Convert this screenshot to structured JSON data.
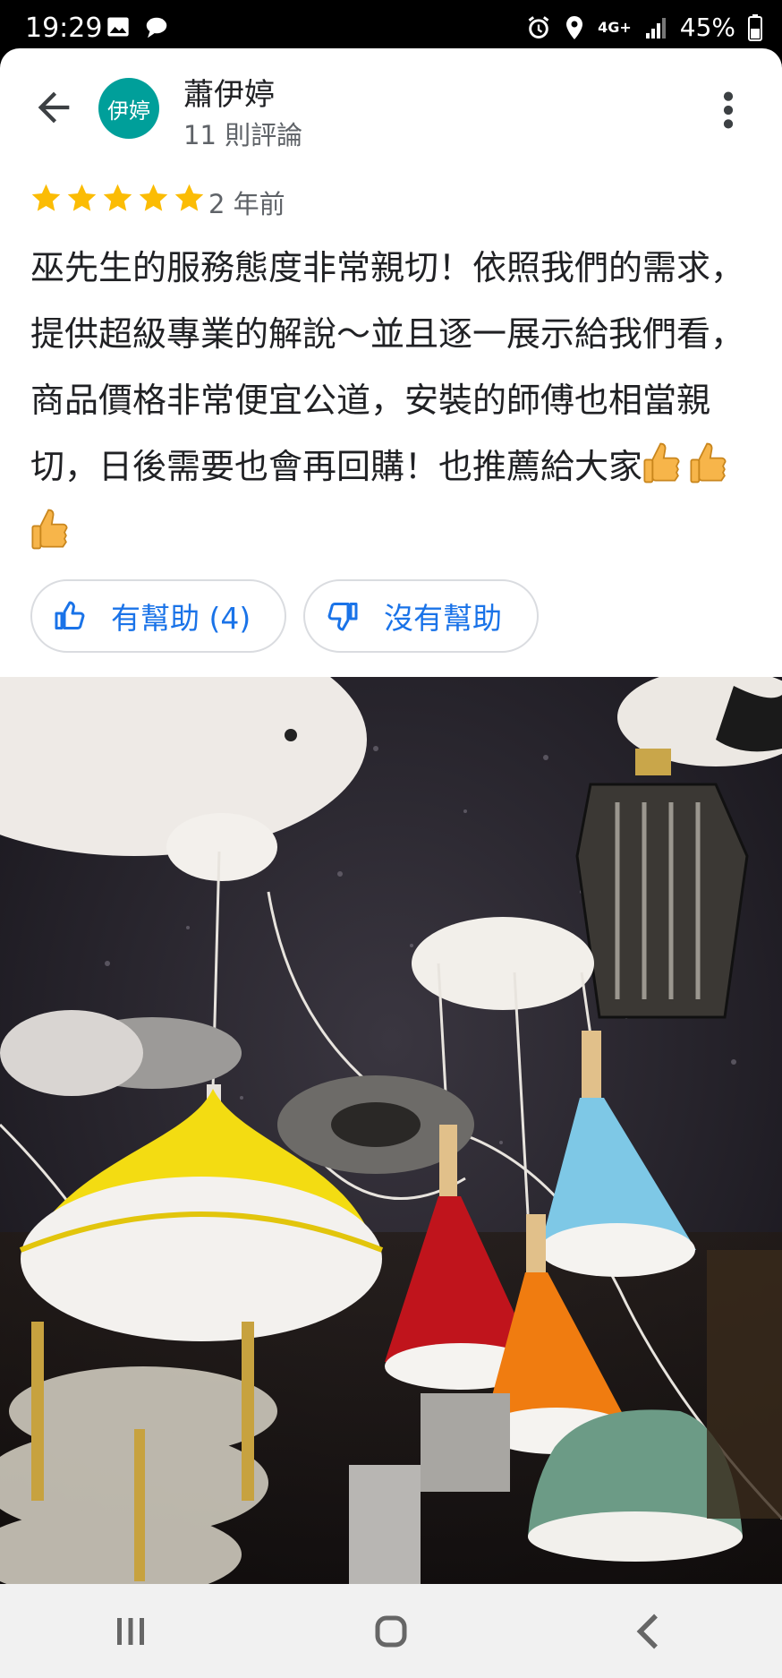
{
  "status": {
    "time": "19:29",
    "battery": "45%",
    "network": "4G+",
    "icons": [
      "image-icon",
      "chat-bubble-icon",
      "alarm-icon",
      "location-icon",
      "signal-icon",
      "battery-icon"
    ]
  },
  "header": {
    "avatar_text": "伊婷",
    "user_name": "蕭伊婷",
    "review_count": "11 則評論",
    "back_icon": "back-arrow-icon",
    "more_icon": "more-vert-icon"
  },
  "review": {
    "rating": 5,
    "time_ago": "2 年前",
    "text": "巫先生的服務態度非常親切！依照我們的需求，提供超級專業的解說～並且逐一展示給我們看，商品價格非常便宜公道，安裝的師傅也相當親切，日後需要也會再回購！也推薦給大家",
    "emojis": [
      "thumbs-up-emoji",
      "thumbs-up-emoji",
      "thumbs-up-emoji"
    ]
  },
  "actions": {
    "helpful_label": "有幫助 (4)",
    "not_helpful_label": "沒有幫助"
  },
  "colors": {
    "accent": "#1a73e8",
    "avatar": "#009f9a",
    "star": "#fbbc04"
  },
  "nav": {
    "icons": [
      "recent-apps-icon",
      "home-icon",
      "back-icon"
    ]
  }
}
